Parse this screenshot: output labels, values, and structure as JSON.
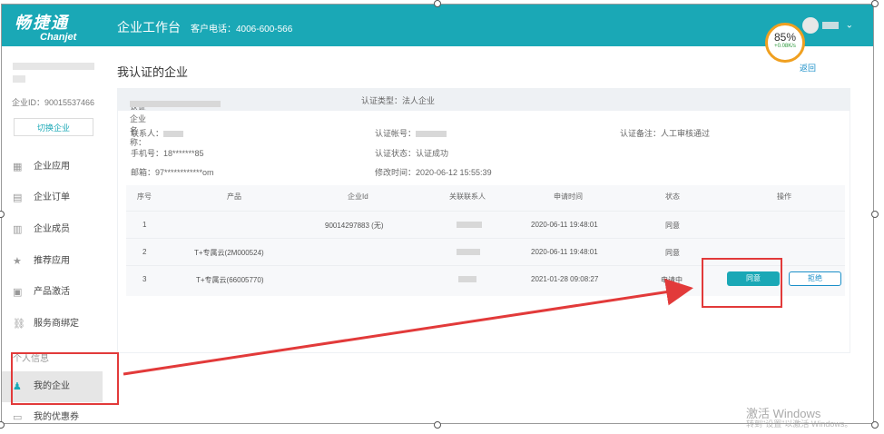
{
  "header": {
    "logo_cn": "畅捷通",
    "logo_en": "Chanjet",
    "title": "企业工作台",
    "hotline": "客户电话：4006-600-566"
  },
  "speed_widget": {
    "percent": "85%",
    "rate": "+0.08K/s"
  },
  "sidebar": {
    "company_id": "企业ID：90015537466",
    "switch_label": "切换企业",
    "items": [
      {
        "label": "企业应用",
        "icon": "grid-icon"
      },
      {
        "label": "企业订单",
        "icon": "order-icon"
      },
      {
        "label": "企业成员",
        "icon": "building-icon"
      },
      {
        "label": "推荐应用",
        "icon": "star-icon"
      },
      {
        "label": "产品激活",
        "icon": "activate-icon"
      },
      {
        "label": "服务商绑定",
        "icon": "link-icon"
      }
    ],
    "section_label": "个人信息",
    "active_item": {
      "label": "我的企业",
      "icon": "person-icon"
    },
    "partial_item": "我的优惠券"
  },
  "main": {
    "title": "我认证的企业",
    "back": "返回",
    "info_bar": {
      "company_name_label": "认证企业名称：",
      "type": "认证类型：法人企业"
    },
    "details": {
      "contact_label": "联系人：",
      "phone": "手机号：18*******85",
      "email": "邮箱：97************om",
      "account_label": "认证帐号：",
      "status": "认证状态：认证成功",
      "modified": "修改时间：2020-06-12 15:55:39",
      "remark": "认证备注：人工审核通过"
    },
    "table": {
      "headers": [
        "序号",
        "产品",
        "企业Id",
        "关联联系人",
        "申请时间",
        "状态",
        "操作"
      ],
      "rows": [
        {
          "no": "1",
          "product": "",
          "company_id": "90014297883 (无)",
          "time": "2020-06-11 19:48:01",
          "status": "同意"
        },
        {
          "no": "2",
          "product": "T+专属云(2M000524)",
          "company_id": "",
          "time": "2020-06-11 19:48:01",
          "status": "同意"
        },
        {
          "no": "3",
          "product": "T+专属云(66005770)",
          "company_id": "",
          "time": "2021-01-28 09:08:27",
          "status": "申请中"
        }
      ],
      "agree_label": "同意",
      "reject_label": "拒绝"
    }
  },
  "watermark": {
    "line1": "激活 Windows",
    "line2": "转到\"设置\"以激活 Windows。"
  },
  "colors": {
    "accent": "#1aa8b6",
    "annotation": "#e23a3a",
    "link": "#1a8fc8"
  }
}
